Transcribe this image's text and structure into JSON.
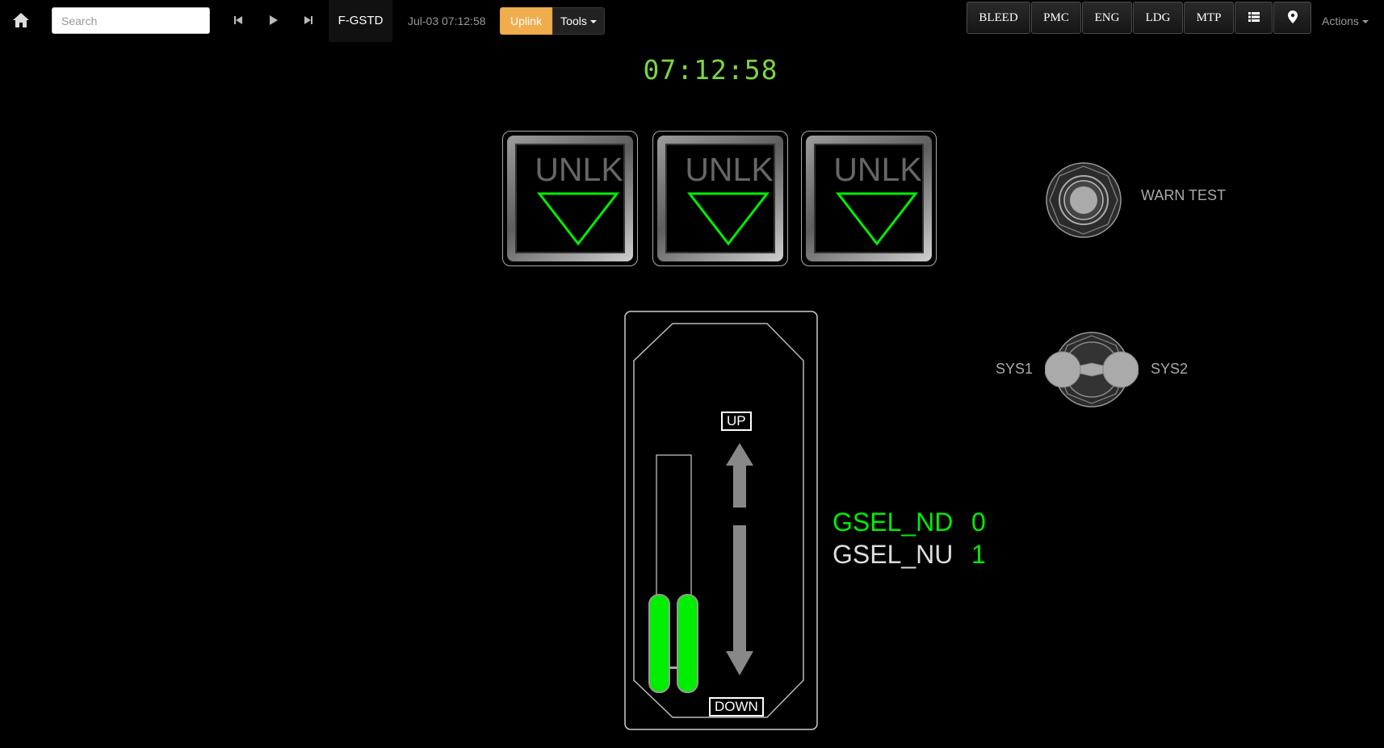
{
  "nav": {
    "search_placeholder": "Search",
    "tail_number": "F-GSTD",
    "datetime": "Jul-03 07:12:58",
    "uplink_label": "Uplink",
    "tools_label": "Tools",
    "system_buttons": [
      "BLEED",
      "PMC",
      "ENG",
      "LDG",
      "MTP"
    ],
    "actions_label": "Actions"
  },
  "main": {
    "clock": "07:12:58",
    "unlock_indicators": [
      "UNLK",
      "UNLK",
      "UNLK"
    ],
    "warn_test_label": "WARN TEST",
    "sys1_label": "SYS1",
    "sys2_label": "SYS2",
    "gear_lever": {
      "up_label": "UP",
      "down_label": "DOWN",
      "position": "DOWN"
    },
    "params": [
      {
        "name": "GSEL_ND",
        "value": "0",
        "name_color": "#00ee00"
      },
      {
        "name": "GSEL_NU",
        "value": "1",
        "name_color": "#dddddd"
      }
    ]
  },
  "colors": {
    "indicator_green": "#00ee00",
    "clock_green": "#7bd641",
    "uplink_orange": "#f0ad4e"
  }
}
